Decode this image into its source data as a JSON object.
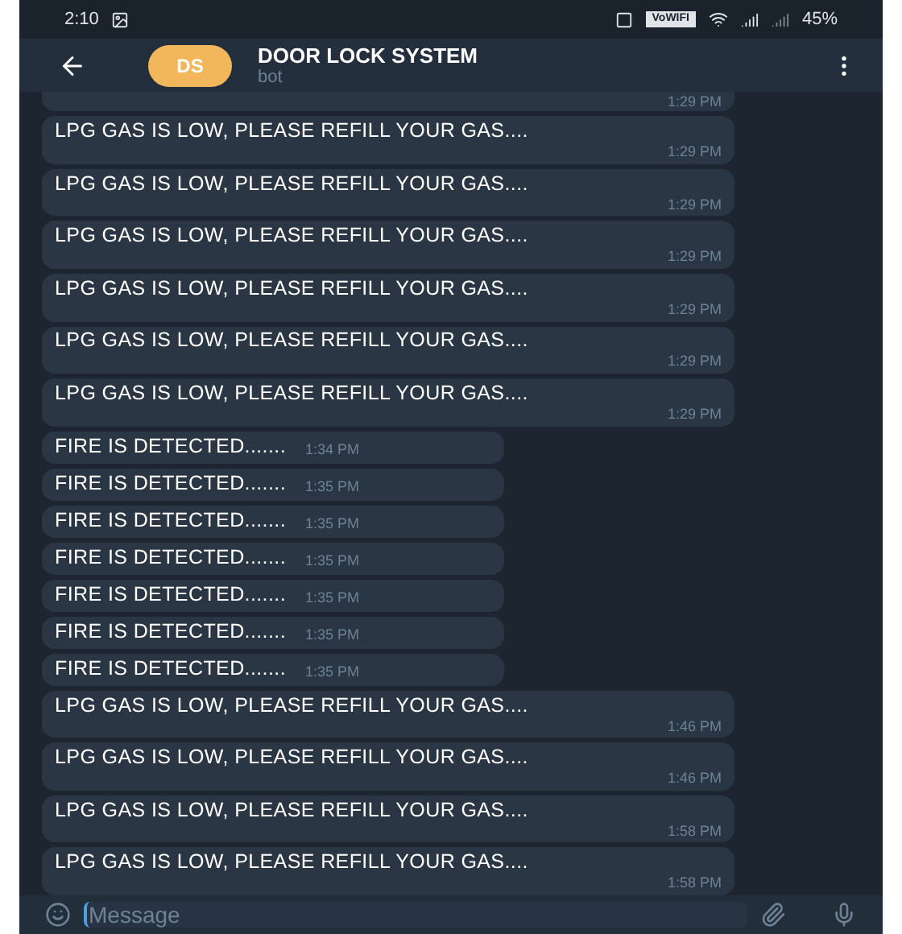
{
  "status_bar": {
    "time": "2:10",
    "wifi_badge": "VoWIFI",
    "battery": "45%"
  },
  "header": {
    "avatar": "DS",
    "title": "DOOR LOCK SYSTEM",
    "subtitle": "bot"
  },
  "messages": [
    {
      "kind": "cut",
      "time": "1:29 PM"
    },
    {
      "kind": "wide",
      "text": "LPG GAS IS LOW, PLEASE REFILL YOUR GAS....",
      "time": "1:29 PM"
    },
    {
      "kind": "wide",
      "text": "LPG GAS IS LOW, PLEASE REFILL YOUR GAS....",
      "time": "1:29 PM"
    },
    {
      "kind": "wide",
      "text": "LPG GAS IS LOW, PLEASE REFILL YOUR GAS....",
      "time": "1:29 PM"
    },
    {
      "kind": "wide",
      "text": "LPG GAS IS LOW, PLEASE REFILL YOUR GAS....",
      "time": "1:29 PM"
    },
    {
      "kind": "wide",
      "text": "LPG GAS IS LOW, PLEASE REFILL YOUR GAS....",
      "time": "1:29 PM"
    },
    {
      "kind": "wide",
      "text": "LPG GAS IS LOW, PLEASE REFILL YOUR GAS....",
      "time": "1:29 PM"
    },
    {
      "kind": "short",
      "text": "FIRE IS DETECTED.......",
      "time": "1:34 PM"
    },
    {
      "kind": "short",
      "text": "FIRE IS DETECTED.......",
      "time": "1:35 PM"
    },
    {
      "kind": "short",
      "text": "FIRE IS DETECTED.......",
      "time": "1:35 PM"
    },
    {
      "kind": "short",
      "text": "FIRE IS DETECTED.......",
      "time": "1:35 PM"
    },
    {
      "kind": "short",
      "text": "FIRE IS DETECTED.......",
      "time": "1:35 PM"
    },
    {
      "kind": "short",
      "text": "FIRE IS DETECTED.......",
      "time": "1:35 PM"
    },
    {
      "kind": "short",
      "text": "FIRE IS DETECTED.......",
      "time": "1:35 PM"
    },
    {
      "kind": "wide",
      "text": "LPG GAS IS LOW, PLEASE REFILL YOUR GAS....",
      "time": "1:46 PM"
    },
    {
      "kind": "wide",
      "text": "LPG GAS IS LOW, PLEASE REFILL YOUR GAS....",
      "time": "1:46 PM"
    },
    {
      "kind": "wide",
      "text": "LPG GAS IS LOW, PLEASE REFILL YOUR GAS....",
      "time": "1:58 PM"
    },
    {
      "kind": "wide",
      "text": "LPG GAS IS LOW, PLEASE REFILL YOUR GAS....",
      "time": "1:58 PM"
    }
  ],
  "composer": {
    "placeholder": "Message"
  }
}
